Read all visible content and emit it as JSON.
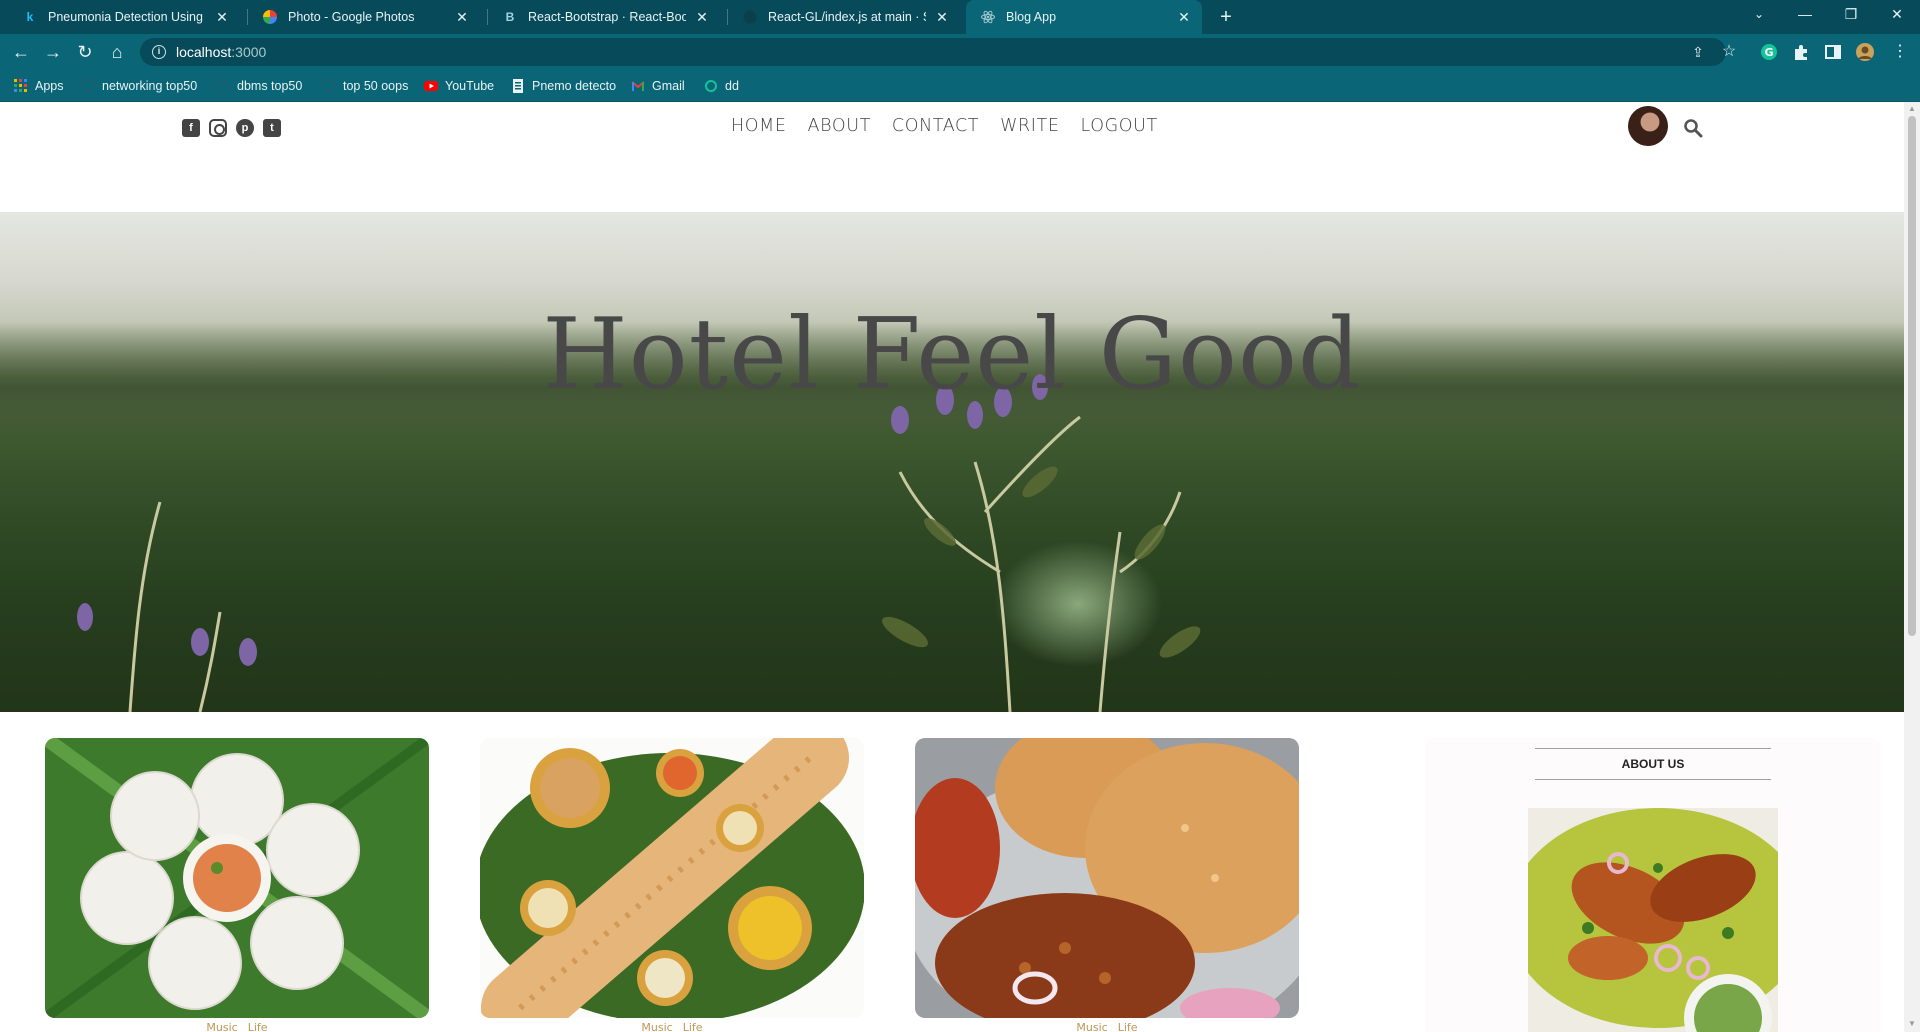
{
  "browser": {
    "tabs": [
      {
        "title": "Pneumonia Detection Using Fast",
        "icon": "kaggle-icon"
      },
      {
        "title": "Photo - Google Photos",
        "icon": "google-photos-icon"
      },
      {
        "title": "React-Bootstrap · React-Bootstrap",
        "icon": "react-bootstrap-icon"
      },
      {
        "title": "React-GL/index.js at main · Sache",
        "icon": "github-icon"
      },
      {
        "title": "Blog App",
        "icon": "react-icon"
      }
    ],
    "url_host": "localhost",
    "url_port": ":3000",
    "bookmarks": [
      {
        "label": "Apps",
        "icon": "apps-grid-icon"
      },
      {
        "label": "networking top50",
        "icon": "globe-icon"
      },
      {
        "label": "dbms top50",
        "icon": "globe-icon"
      },
      {
        "label": "top 50 oops",
        "icon": "globe-icon"
      },
      {
        "label": "YouTube",
        "icon": "youtube-icon"
      },
      {
        "label": "Pnemo detecto",
        "icon": "document-icon"
      },
      {
        "label": "Gmail",
        "icon": "gmail-icon"
      },
      {
        "label": "dd",
        "icon": "grammarly-icon"
      }
    ]
  },
  "site": {
    "social_icons": [
      "facebook-icon",
      "instagram-icon",
      "pinterest-icon",
      "twitter-icon"
    ],
    "nav": {
      "home": "HOME",
      "about": "ABOUT",
      "contact": "CONTACT",
      "write": "WRITE",
      "logout": "LOGOUT"
    },
    "hero_title": "Hotel Feel Good",
    "posts": [
      {
        "image": "idli-with-chutney",
        "cats": [
          "Music",
          "Life"
        ]
      },
      {
        "image": "masala-dosa-platter",
        "cats": [
          "Music",
          "Life"
        ]
      },
      {
        "image": "chole-bhature",
        "cats": [
          "Music",
          "Life"
        ]
      }
    ],
    "sidebar": {
      "title": "ABOUT US",
      "image": "tandoori-chicken"
    }
  },
  "colors": {
    "chrome_dark": "#074a5a",
    "chrome": "#0a6577",
    "category": "#be9656",
    "nav_text": "#444444"
  }
}
